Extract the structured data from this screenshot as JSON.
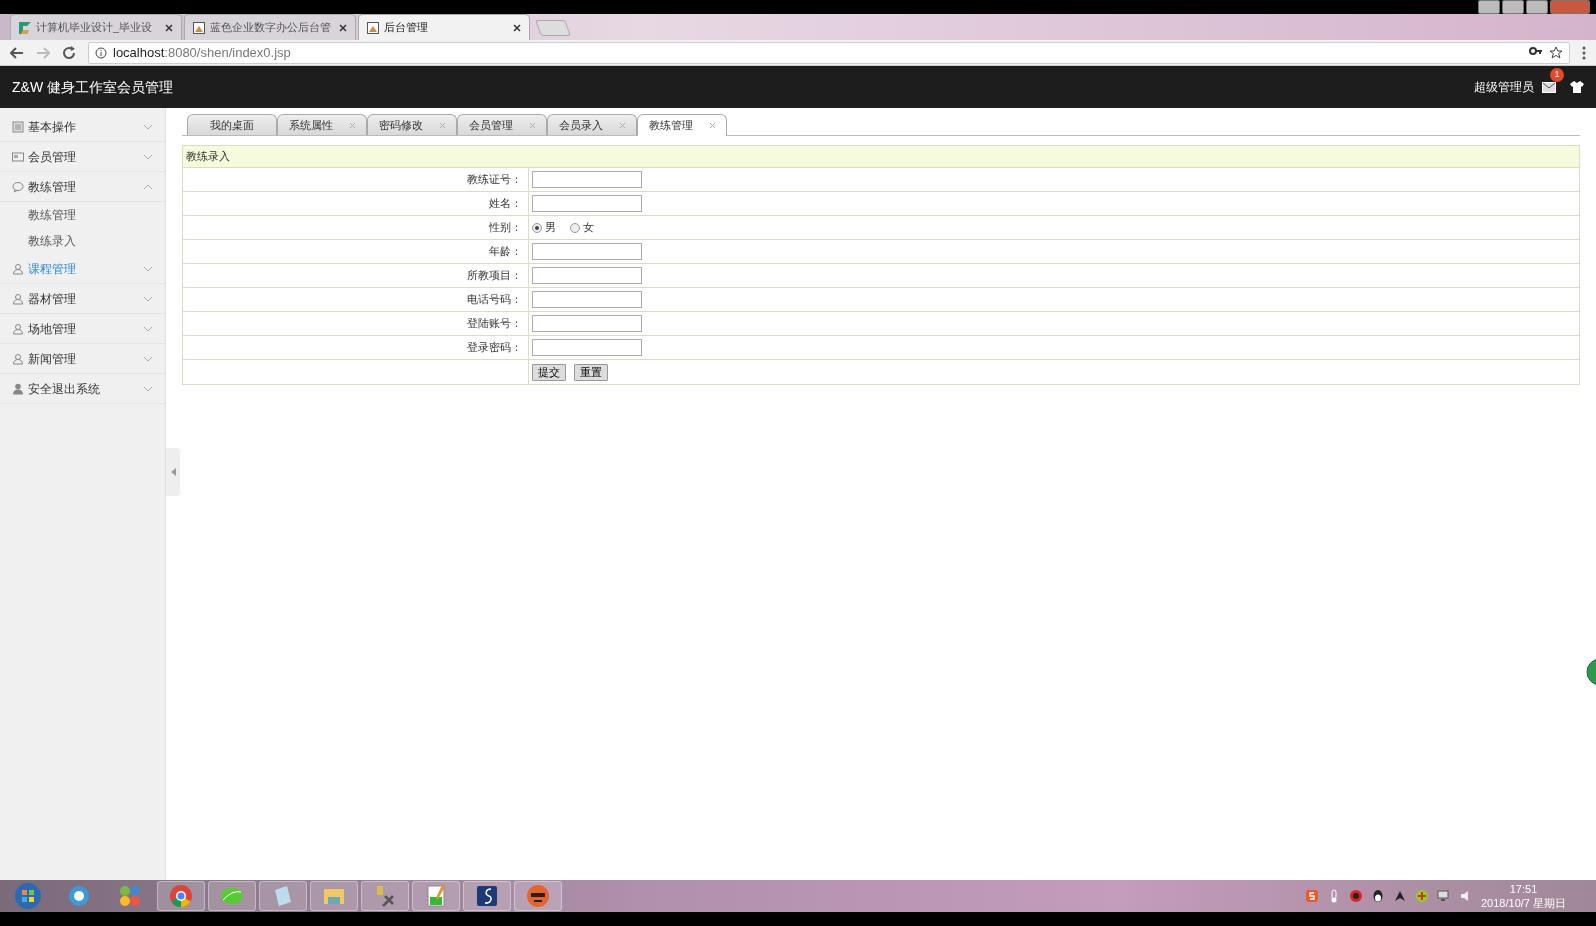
{
  "browser": {
    "tabs": [
      {
        "title": "计算机毕业设计_毕业设",
        "selected": false,
        "kind": "brand"
      },
      {
        "title": "蓝色企业数字办公后台管",
        "selected": false,
        "kind": "page"
      },
      {
        "title": "后台管理",
        "selected": true,
        "kind": "page"
      }
    ],
    "url_host": "localhost",
    "url_path": ":8080/shen/index0.jsp"
  },
  "app": {
    "title": "Z&W 健身工作室会员管理",
    "user": "超级管理员",
    "mail_badge": "1"
  },
  "sidebar": {
    "items": [
      {
        "label": "基本操作",
        "kind": "list",
        "expanded": false,
        "hovered": false
      },
      {
        "label": "会员管理",
        "kind": "card",
        "expanded": false,
        "hovered": false
      },
      {
        "label": "教练管理",
        "kind": "chat",
        "expanded": true,
        "hovered": false,
        "children": [
          {
            "label": "教练管理"
          },
          {
            "label": "教练录入"
          }
        ]
      },
      {
        "label": "课程管理",
        "kind": "user",
        "expanded": false,
        "hovered": true
      },
      {
        "label": "器材管理",
        "kind": "user",
        "expanded": false,
        "hovered": false
      },
      {
        "label": "场地管理",
        "kind": "user",
        "expanded": false,
        "hovered": false
      },
      {
        "label": "新闻管理",
        "kind": "user",
        "expanded": false,
        "hovered": false
      },
      {
        "label": "安全退出系统",
        "kind": "person",
        "expanded": false,
        "hovered": false
      }
    ]
  },
  "tabs": [
    {
      "label": "我的桌面",
      "closable": false,
      "selected": false
    },
    {
      "label": "系统属性",
      "closable": true,
      "selected": false
    },
    {
      "label": "密码修改",
      "closable": true,
      "selected": false
    },
    {
      "label": "会员管理",
      "closable": true,
      "selected": false
    },
    {
      "label": "会员录入",
      "closable": true,
      "selected": false
    },
    {
      "label": "教练管理",
      "closable": true,
      "selected": true
    }
  ],
  "form": {
    "title": "教练录入",
    "fields": [
      {
        "label": "教练证号：",
        "kind": "text"
      },
      {
        "label": "姓名：",
        "kind": "text"
      },
      {
        "label": "性别：",
        "kind": "radio",
        "options": [
          {
            "label": "男",
            "selected": true
          },
          {
            "label": "女",
            "selected": false
          }
        ]
      },
      {
        "label": "年龄：",
        "kind": "text"
      },
      {
        "label": "所教项目：",
        "kind": "text"
      },
      {
        "label": "电话号码：",
        "kind": "text"
      },
      {
        "label": "登陆账号：",
        "kind": "text"
      },
      {
        "label": "登录密码：",
        "kind": "text"
      }
    ],
    "buttons": [
      "提交",
      "重置"
    ]
  },
  "taskbar": {
    "time": "17:51",
    "date": "2018/10/7 星期日"
  }
}
